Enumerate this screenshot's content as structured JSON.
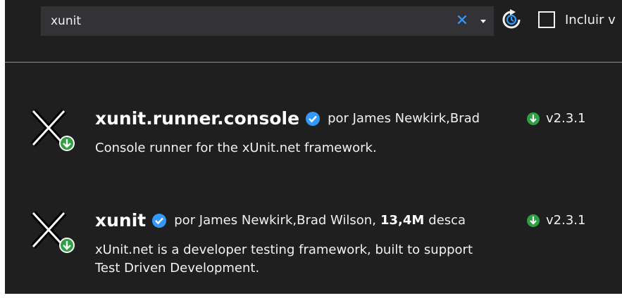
{
  "search": {
    "value": "xunit",
    "clear_glyph": "✕",
    "include_prerelease_label": "Incluir v"
  },
  "colors": {
    "background": "#1f1f1f",
    "search_bg": "#333337",
    "accent_blue": "#3399ff",
    "download_green": "#2ea043"
  },
  "packages": [
    {
      "name": "xunit.runner.console",
      "author": "por James Newkirk,Brad",
      "downloads": "",
      "downloads_suffix": "",
      "description": "Console runner for the xUnit.net framework.",
      "version": "v2.3.1",
      "icon": "xunit-logo-icon"
    },
    {
      "name": "xunit",
      "author": "por James Newkirk,Brad Wilson,",
      "downloads": "13,4M",
      "downloads_suffix": "desca",
      "description": "xUnit.net is a developer testing framework, built to support Test Driven Development.",
      "version": "v2.3.1",
      "icon": "xunit-logo-icon"
    }
  ]
}
